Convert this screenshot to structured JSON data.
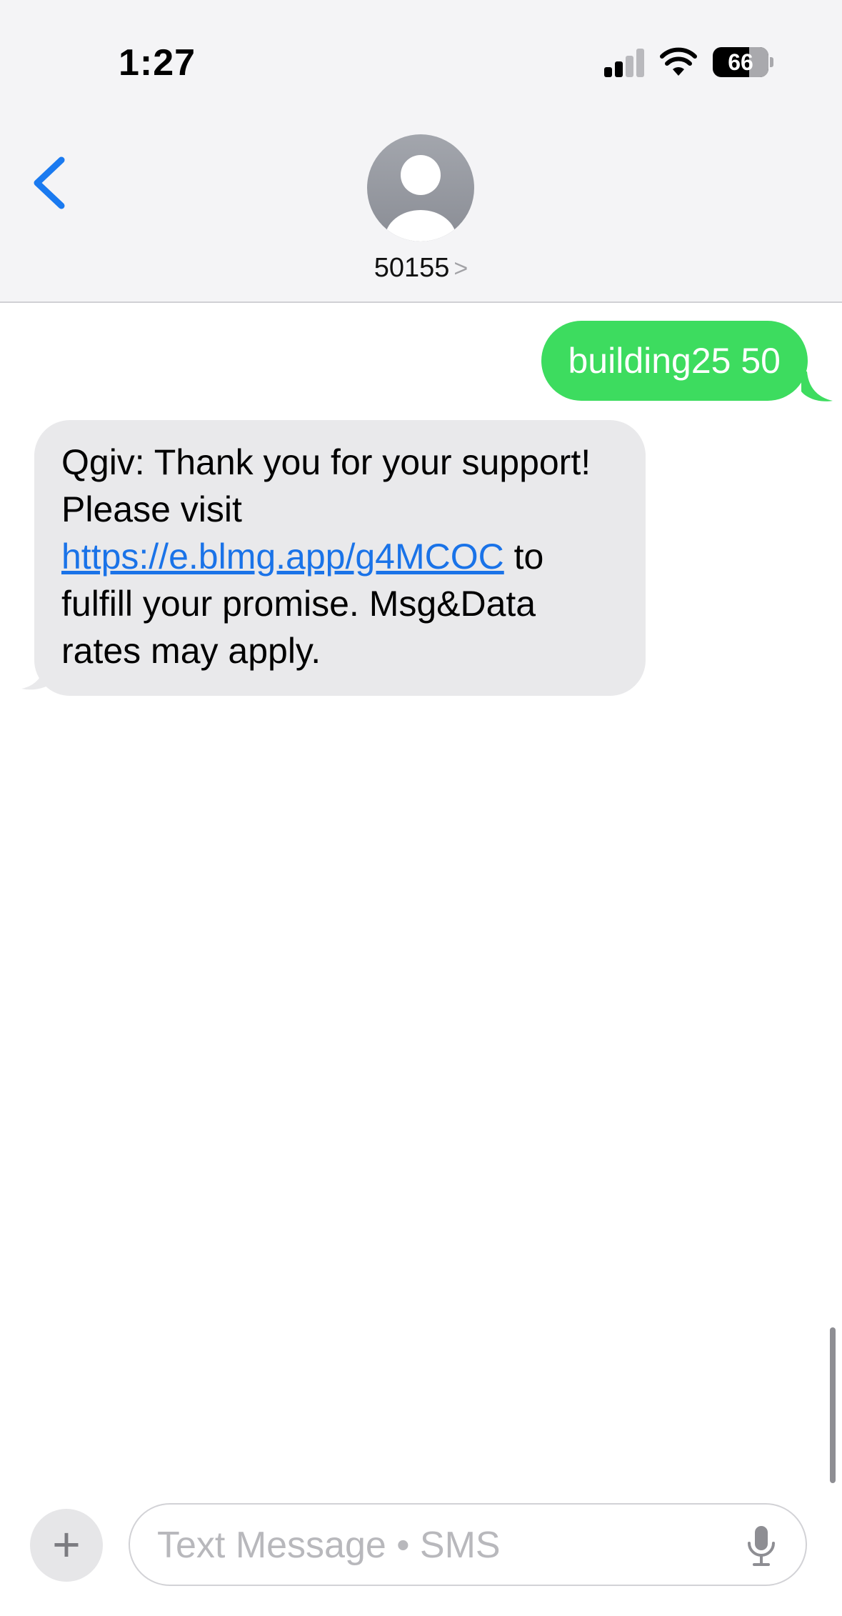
{
  "status_bar": {
    "time": "1:27",
    "battery_percent": "66",
    "battery_level": 0.66,
    "signal_bars": 2,
    "icons": [
      "cellular-signal-icon",
      "wifi-icon",
      "battery-icon"
    ]
  },
  "header": {
    "back_icon": "chevron-left-icon",
    "avatar_icon": "person-silhouette-icon",
    "contact_name": "50155",
    "contact_chevron": ">"
  },
  "messages": {
    "outgoing": {
      "text": "building25 50"
    },
    "incoming": {
      "text_before_link": "Qgiv: Thank you for your support! Please visit ",
      "link": "https://e.blmg.app/g4MCOC",
      "text_after_link": " to fulfill your promise. Msg&Data rates may apply."
    }
  },
  "input_bar": {
    "plus_label": "+",
    "placeholder": "Text Message • SMS",
    "mic_icon": "microphone-icon"
  },
  "colors": {
    "header_bg": "#f4f4f6",
    "outgoing_bubble": "#3ddc5f",
    "incoming_bubble": "#e9e9eb",
    "link": "#1a73e8",
    "accent_blue": "#1a7af0",
    "avatar": "#8e9198"
  }
}
